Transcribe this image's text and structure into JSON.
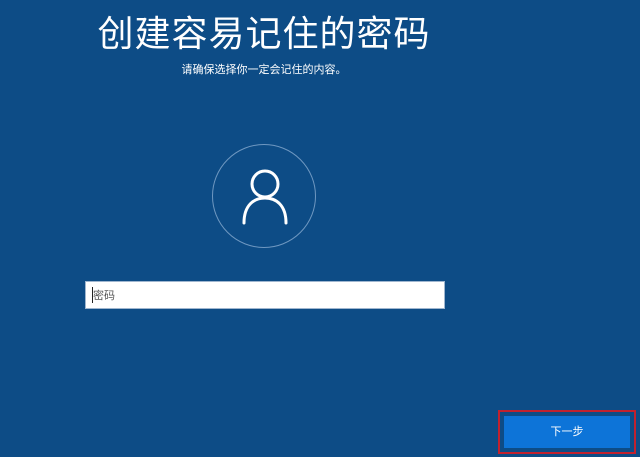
{
  "header": {
    "title": "创建容易记住的密码",
    "subtitle": "请确保选择你一定会记住的内容。"
  },
  "avatar": {
    "icon": "user-icon"
  },
  "password": {
    "placeholder": "密码",
    "value": ""
  },
  "footer": {
    "next_label": "下一步"
  },
  "colors": {
    "background": "#0d4c86",
    "button": "#0d74d8",
    "highlight": "#c1212e"
  }
}
